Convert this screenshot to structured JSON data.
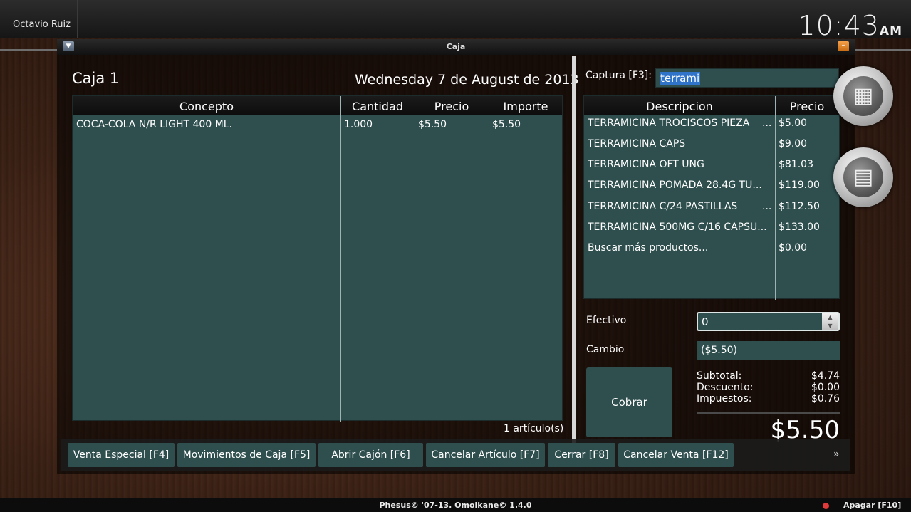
{
  "topbar": {
    "user_name": "Octavio Ruiz",
    "clock_time": "10:43",
    "clock_ampm": "AM"
  },
  "window": {
    "title": "Caja"
  },
  "register": {
    "title": "Caja 1",
    "date": "Wednesday 7 de August de 2013",
    "item_count": "1 artículo(s)"
  },
  "ticket_table": {
    "headers": [
      "Concepto",
      "Cantidad",
      "Precio",
      "Importe"
    ],
    "rows": [
      {
        "concepto": "COCA-COLA N/R LIGHT 400 ML.",
        "cantidad": "1.000",
        "precio": "$5.50",
        "importe": "$5.50"
      }
    ]
  },
  "capture": {
    "label": "Captura [F3]:",
    "value": "terrami"
  },
  "products": {
    "headers": [
      "Descripcion",
      "Precio"
    ],
    "rows": [
      {
        "desc": "TERRAMICINA TROCISCOS PIEZA",
        "ellipsis": "...",
        "price": "$5.00"
      },
      {
        "desc": "TERRAMICINA CAPS",
        "ellipsis": "",
        "price": "$9.00"
      },
      {
        "desc": "TERRAMICINA OFT UNG",
        "ellipsis": "",
        "price": "$81.03"
      },
      {
        "desc": "TERRAMICINA POMADA 28.4G TU...",
        "ellipsis": "",
        "price": "$119.00"
      },
      {
        "desc": "TERRAMICINA C/24 PASTILLAS",
        "ellipsis": "...",
        "price": "$112.50"
      },
      {
        "desc": "TERRAMICINA 500MG C/16 CAPSU...",
        "ellipsis": "",
        "price": "$133.00"
      },
      {
        "desc": "Buscar más productos...",
        "ellipsis": "",
        "price": "$0.00"
      }
    ]
  },
  "payment": {
    "efectivo_label": "Efectivo",
    "efectivo_value": "0",
    "cambio_label": "Cambio",
    "cambio_value": "($5.50)",
    "cobrar_label": "Cobrar",
    "subtotal_label": "Subtotal:",
    "subtotal": "$4.74",
    "descuento_label": "Descuento:",
    "descuento": "$0.00",
    "impuestos_label": "Impuestos:",
    "impuestos": "$0.76",
    "total": "$5.50"
  },
  "function_buttons": [
    "Venta Especial [F4]",
    "Movimientos de Caja [F5]",
    "Abrir Cajón [F6]",
    "Cancelar Artículo [F7]",
    "Cerrar [F8]",
    "Cancelar Venta [F12]"
  ],
  "more_label": "»",
  "side_buttons": [
    {
      "icon": "calculator-icon",
      "glyph": "▦"
    },
    {
      "icon": "calendar-icon",
      "glyph": "▤"
    }
  ],
  "statusbar": {
    "copyright": "Phesus© '07-13. Omoikane© 1.4.0",
    "shutdown_label": "Apagar [F10]",
    "status_color": "#e23a3a"
  },
  "colors": {
    "panel": "#2f4f4f",
    "selection": "#2f74c9",
    "accent_orange": "#e88a2a"
  }
}
